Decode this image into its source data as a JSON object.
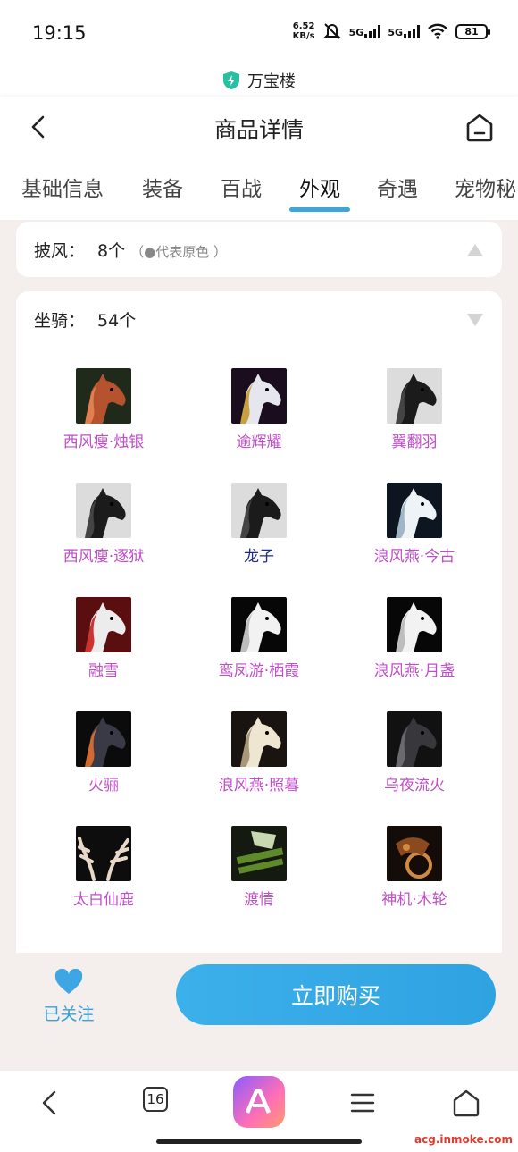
{
  "status": {
    "time": "19:15",
    "net_speed_value": "6.52",
    "net_speed_unit": "KB/s",
    "sim1": "5G",
    "sim2": "5G",
    "battery": "81"
  },
  "site": {
    "title": "万宝楼"
  },
  "header": {
    "title": "商品详情"
  },
  "tabs": [
    {
      "label": "基础信息"
    },
    {
      "label": "装备"
    },
    {
      "label": "百战"
    },
    {
      "label": "外观"
    },
    {
      "label": "奇遇"
    },
    {
      "label": "宠物秘"
    }
  ],
  "cape": {
    "label": "披风：",
    "count": "8个",
    "note": "（●代表原色 ）"
  },
  "mount": {
    "label": "坐骑：",
    "count": "54个"
  },
  "mount_items": [
    {
      "name": "西风瘦·烛银",
      "color": "#c04ec8",
      "icon": "horse-red-icon"
    },
    {
      "name": "逾辉耀",
      "color": "#c04ec8",
      "icon": "unicorn-gold-icon"
    },
    {
      "name": "翼翻羽",
      "color": "#c04ec8",
      "icon": "horse-black-icon"
    },
    {
      "name": "西风瘦·逐狱",
      "color": "#c04ec8",
      "icon": "horse-black-icon"
    },
    {
      "name": "龙子",
      "color": "#1a2a8a",
      "icon": "horse-black-icon"
    },
    {
      "name": "浪风燕·今古",
      "color": "#c04ec8",
      "icon": "horse-white-mane-icon"
    },
    {
      "name": "融雪",
      "color": "#c04ec8",
      "icon": "horse-white-red-icon"
    },
    {
      "name": "鸾凤游·栖霞",
      "color": "#c04ec8",
      "icon": "horse-white-icon"
    },
    {
      "name": "浪风燕·月盏",
      "color": "#c04ec8",
      "icon": "horse-white-icon"
    },
    {
      "name": "火骊",
      "color": "#c04ec8",
      "icon": "horse-dark-icon"
    },
    {
      "name": "浪风燕·照暮",
      "color": "#c04ec8",
      "icon": "horse-cream-icon"
    },
    {
      "name": "乌夜流火",
      "color": "#c04ec8",
      "icon": "horse-armored-icon"
    },
    {
      "name": "太白仙鹿",
      "color": "#c04ec8",
      "icon": "antler-icon"
    },
    {
      "name": "渡情",
      "color": "#c04ec8",
      "icon": "bamboo-raft-icon"
    },
    {
      "name": "神机·木轮",
      "color": "#c04ec8",
      "icon": "mech-wheel-icon"
    }
  ],
  "buy_bar": {
    "follow_label": "已关注",
    "buy_label": "立即购买"
  },
  "browser": {
    "tab_count": "16"
  },
  "watermark": "acg.inmoke.com",
  "colors": {
    "accent": "#3ea6d6",
    "item_purple": "#c04ec8",
    "item_blue": "#1a2a8a"
  }
}
